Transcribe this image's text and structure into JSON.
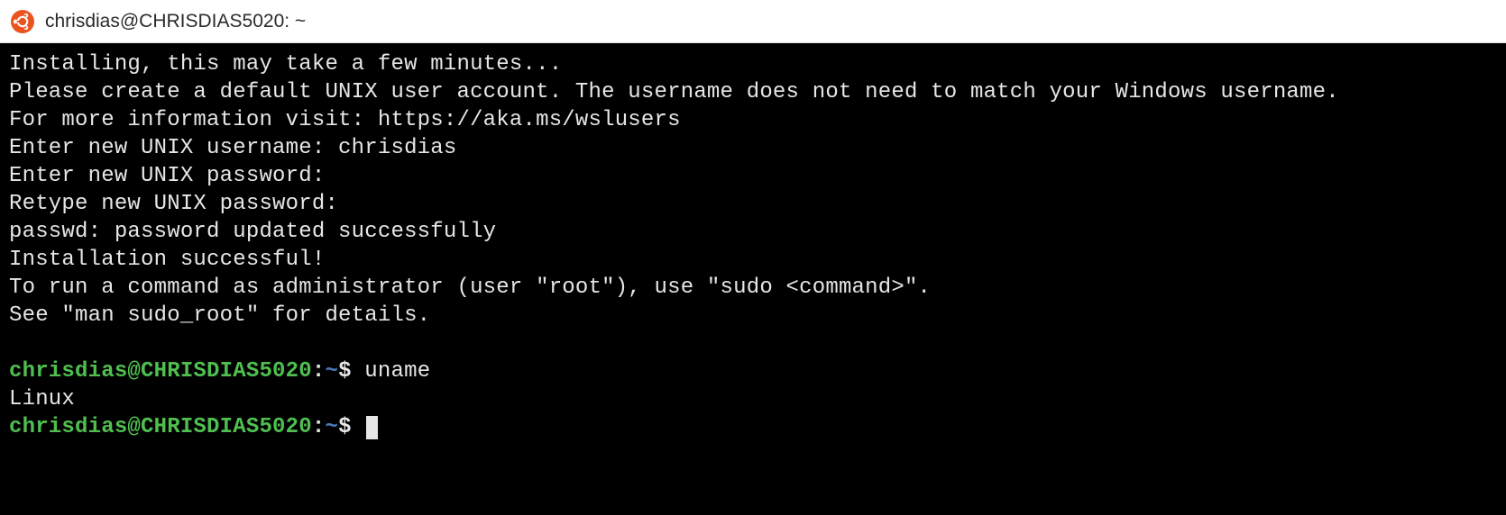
{
  "window": {
    "title": "chrisdias@CHRISDIAS5020: ~"
  },
  "terminal": {
    "lines": [
      "Installing, this may take a few minutes...",
      "Please create a default UNIX user account. The username does not need to match your Windows username.",
      "For more information visit: https://aka.ms/wslusers",
      "Enter new UNIX username: chrisdias",
      "Enter new UNIX password:",
      "Retype new UNIX password:",
      "passwd: password updated successfully",
      "Installation successful!",
      "To run a command as administrator (user \"root\"), use \"sudo <command>\".",
      "See \"man sudo_root\" for details."
    ],
    "prompt1": {
      "user_host": "chrisdias@CHRISDIAS5020",
      "colon": ":",
      "path": "~",
      "dollar": "$",
      "command": " uname"
    },
    "output1": "Linux",
    "prompt2": {
      "user_host": "chrisdias@CHRISDIAS5020",
      "colon": ":",
      "path": "~",
      "dollar": "$",
      "command": " "
    }
  }
}
